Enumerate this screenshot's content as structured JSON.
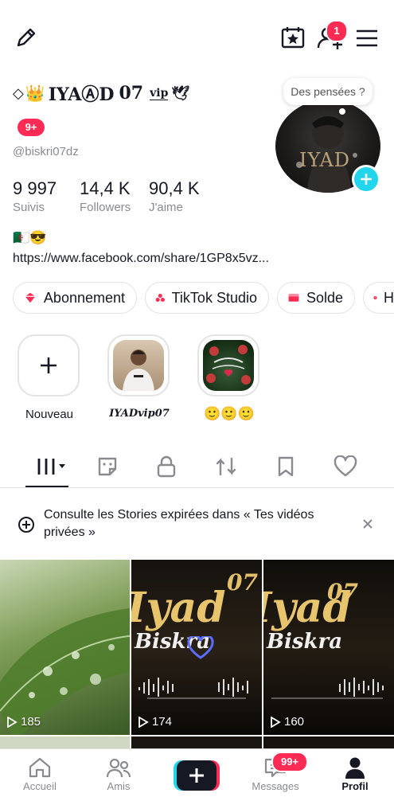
{
  "header": {
    "notif_count": "1",
    "icons": [
      "pencil-icon",
      "calendar-star-icon",
      "add-friend-icon",
      "menu-icon"
    ]
  },
  "profile": {
    "display_name_part1": "IYAⒶD",
    "display_name_part2": "07",
    "vip_mark": "vip",
    "level_badge": "9+",
    "username": "@biskri07dz",
    "thought_bubble": "Des pensées ?",
    "avatar_text": "IYAD",
    "stats": [
      {
        "value": "9 997",
        "label": "Suivis"
      },
      {
        "value": "14,4 K",
        "label": "Followers"
      },
      {
        "value": "90,4 K",
        "label": "J'aime"
      }
    ],
    "bio_emoji": "🇩🇿😎",
    "link": "https://www.facebook.com/share/1GP8x5vz..."
  },
  "chips": [
    {
      "label": "Abonnement",
      "icon": "subscription-icon"
    },
    {
      "label": "TikTok Studio",
      "icon": "studio-icon"
    },
    {
      "label": "Solde",
      "icon": "wallet-icon"
    },
    {
      "label": "H",
      "icon": "clock-icon"
    }
  ],
  "stories": [
    {
      "label": "Nouveau"
    },
    {
      "label": "IYADvip07"
    },
    {
      "label": "🙂🙂🙂"
    }
  ],
  "tabs": [
    "grid-icon",
    "repost-sticker-icon",
    "lock-icon",
    "repost-icon",
    "bookmark-icon",
    "heart-icon"
  ],
  "banner": {
    "text": "Consulte les Stories expirées dans « Tes vidéos privées »"
  },
  "videos": [
    {
      "views": "185"
    },
    {
      "views": "174",
      "title": "Iyad",
      "subtitle": "Biskra",
      "num": "07"
    },
    {
      "views": "160",
      "title": "Iyad",
      "subtitle": "Biskra",
      "num": "07"
    }
  ],
  "bottom_nav": [
    {
      "label": "Accueil"
    },
    {
      "label": "Amis"
    },
    {
      "label": ""
    },
    {
      "label": "Messages",
      "badge": "99+"
    },
    {
      "label": "Profil"
    }
  ],
  "colors": {
    "accent": "#fe2c55",
    "blue": "#20d5ec",
    "grey": "#8a8b91"
  }
}
